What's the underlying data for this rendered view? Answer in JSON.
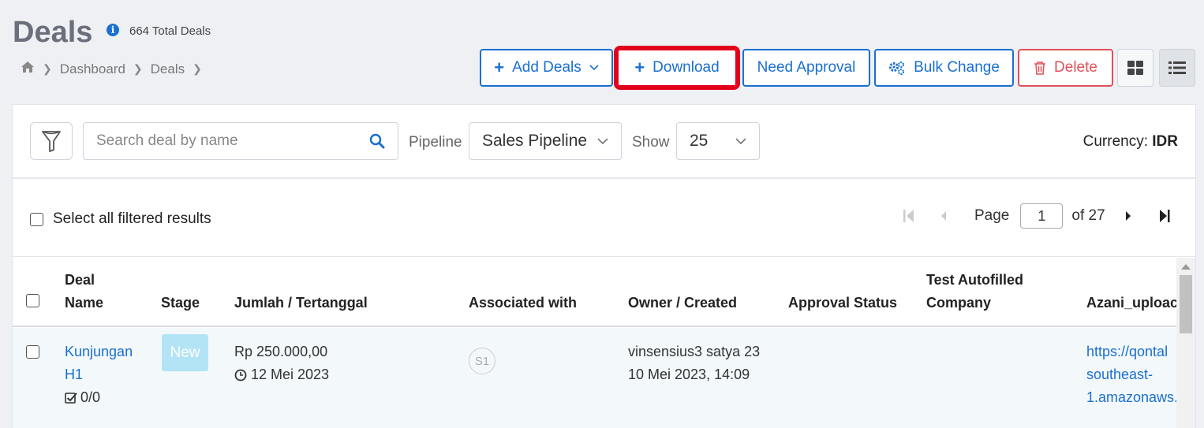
{
  "header": {
    "title": "Deals",
    "total_deals": "664 Total Deals",
    "breadcrumb": [
      "Dashboard",
      "Deals"
    ]
  },
  "toolbar": {
    "add_deals": "Add Deals",
    "download": "Download",
    "need_approval": "Need Approval",
    "bulk_change": "Bulk Change",
    "delete": "Delete"
  },
  "filters": {
    "search_placeholder": "Search deal by name",
    "pipeline_label": "Pipeline",
    "pipeline_value": "Sales Pipeline",
    "show_label": "Show",
    "show_value": "25",
    "currency_label": "Currency:",
    "currency_value": "IDR"
  },
  "selection": {
    "select_all": "Select all filtered results"
  },
  "pagination": {
    "page_label": "Page",
    "current_page": "1",
    "of_total": "of 27"
  },
  "table": {
    "headers": {
      "deal_name_1": "Deal",
      "deal_name_2": "Name",
      "stage": "Stage",
      "amount": "Jumlah / Tertanggal",
      "associated": "Associated with",
      "owner": "Owner / Created",
      "approval": "Approval Status",
      "test_1": "Test Autofilled",
      "test_2": "Company",
      "azani": "Azani_uploac"
    },
    "rows": [
      {
        "name_1": "Kunjungan",
        "name_2": "H1",
        "tasks": "0/0",
        "stage": "New",
        "amount": "Rp 250.000,00",
        "date": "12 Mei 2023",
        "associated": "S1",
        "owner": "vinsensius3 satya 23",
        "created": "10 Mei 2023, 14:09",
        "azani_1": "https://qontal",
        "azani_2": "southeast-",
        "azani_3": "1.amazonaws."
      }
    ]
  },
  "colors": {
    "primary": "#1a6fd1",
    "danger": "#e0505a",
    "highlight": "#e3001b",
    "stage_new": "#b3e4f5"
  }
}
